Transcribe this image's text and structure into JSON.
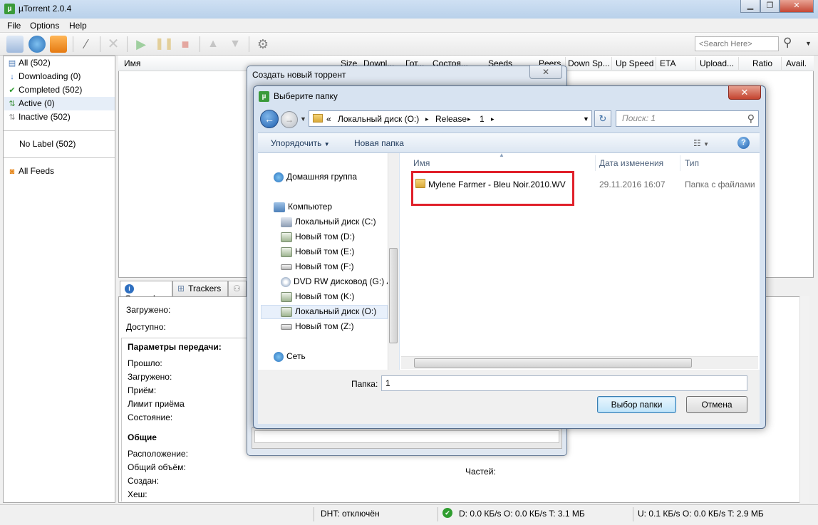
{
  "main_window": {
    "title": "µTorrent 2.0.4",
    "menu": [
      "File",
      "Options",
      "Help"
    ],
    "search_placeholder": "<Search Here>"
  },
  "sidebar": {
    "items": [
      {
        "label": "All (502)",
        "icon": "list-icon"
      },
      {
        "label": "Downloading (0)",
        "icon": "download-arrow-icon"
      },
      {
        "label": "Completed (502)",
        "icon": "checkmark-icon"
      },
      {
        "label": "Active (0)",
        "icon": "updown-arrows-icon"
      },
      {
        "label": "Inactive (502)",
        "icon": "inactive-arrows-icon"
      }
    ],
    "no_label": "No Label (502)",
    "feeds": "All Feeds"
  },
  "list_columns": [
    "Имя",
    "Size",
    "Downl...",
    "Гот...",
    "Состоя...",
    "Seeds",
    "Peers",
    "Down Sp...",
    "Up Speed",
    "ETA",
    "Upload...",
    "Ratio",
    "Avail."
  ],
  "details_tabs": [
    "General",
    "Trackers"
  ],
  "details": {
    "downloaded": "Загружено:",
    "available": "Доступно:",
    "transfer_header": "Параметры передачи:",
    "elapsed": "Прошло:",
    "downloaded2": "Загружено:",
    "receive": "Приём:",
    "receive_limit": "Лимит приёма",
    "state": "Состояние:",
    "general_header": "Общие",
    "location": "Расположение:",
    "total_size": "Общий объём:",
    "created": "Создан:",
    "hash": "Хеш:",
    "pieces": "Частей:"
  },
  "statusbar": {
    "dht": "DHT: отключён",
    "down": "D: 0.0 КБ/s O: 0.0 КБ/s T: 3.1 МБ",
    "up": "U: 0.1 КБ/s O: 0.0 КБ/s T: 2.9 МБ"
  },
  "create_dialog": {
    "title": "Создать новый торрент"
  },
  "folder_dialog": {
    "title": "Выберите папку",
    "breadcrumb": [
      "«",
      "Локальный диск (O:)",
      "▸",
      "Release",
      "▸",
      "1",
      "▸"
    ],
    "search_placeholder": "Поиск: 1",
    "organize": "Упорядочить",
    "new_folder": "Новая папка",
    "nav_items": [
      {
        "label": "Домашняя группа",
        "icon": "homegroup-icon"
      },
      {
        "label": "Компьютер",
        "icon": "computer-icon"
      },
      {
        "label": "Локальный диск (C:)",
        "icon": "system-drive-icon"
      },
      {
        "label": "Новый том (D:)",
        "icon": "drive-icon"
      },
      {
        "label": "Новый том (E:)",
        "icon": "drive-icon"
      },
      {
        "label": "Новый том (F:)",
        "icon": "removable-drive-icon"
      },
      {
        "label": "DVD RW дисковод (G:) A",
        "icon": "dvd-icon"
      },
      {
        "label": "Новый том (K:)",
        "icon": "drive-icon"
      },
      {
        "label": "Локальный диск (O:)",
        "icon": "drive-icon"
      },
      {
        "label": "Новый том (Z:)",
        "icon": "removable-drive-icon"
      },
      {
        "label": "Сеть",
        "icon": "network-icon"
      }
    ],
    "columns": [
      "Имя",
      "Дата изменения",
      "Тип"
    ],
    "files": [
      {
        "name": "Mylene Farmer - Bleu Noir.2010.WV",
        "date": "29.11.2016 16:07",
        "type": "Папка с файлами"
      }
    ],
    "folder_label": "Папка:",
    "folder_value": "1",
    "ok": "Выбор папки",
    "cancel": "Отмена"
  },
  "colors": {
    "highlight_box": "#e0202a",
    "accent_blue": "#1f5fae"
  }
}
